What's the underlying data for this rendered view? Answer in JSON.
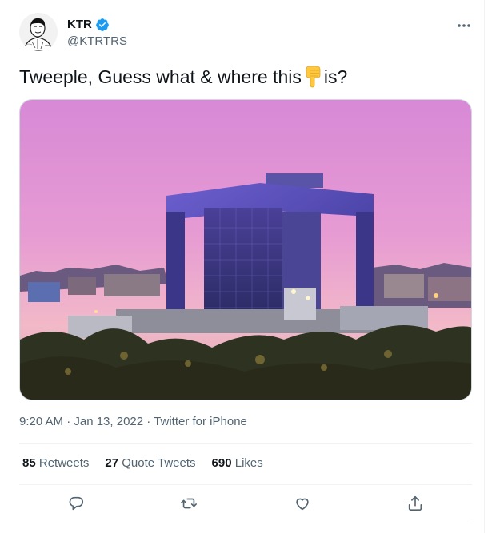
{
  "tweet": {
    "author_name": "KTR",
    "author_handle": "@KTRTRS",
    "text_before": "Tweeple, Guess what & where this",
    "text_after": "is?",
    "emoji": "backhand-index-pointing-down",
    "meta": "9:20 AM · Jan 13, 2022 · Twitter for iPhone",
    "stats": [
      {
        "count": "85",
        "label": "Retweets"
      },
      {
        "count": "27",
        "label": "Quote Tweets"
      },
      {
        "count": "690",
        "label": "Likes"
      }
    ]
  },
  "icons": {
    "verified": "verified-badge-icon",
    "more": "more-icon",
    "reply": "reply-icon",
    "retweet": "retweet-icon",
    "like": "like-icon",
    "share": "share-icon"
  },
  "colors": {
    "accent": "#1d9bf0",
    "text_primary": "#0f1419",
    "text_secondary": "#536471",
    "divider": "#eff3f4"
  }
}
